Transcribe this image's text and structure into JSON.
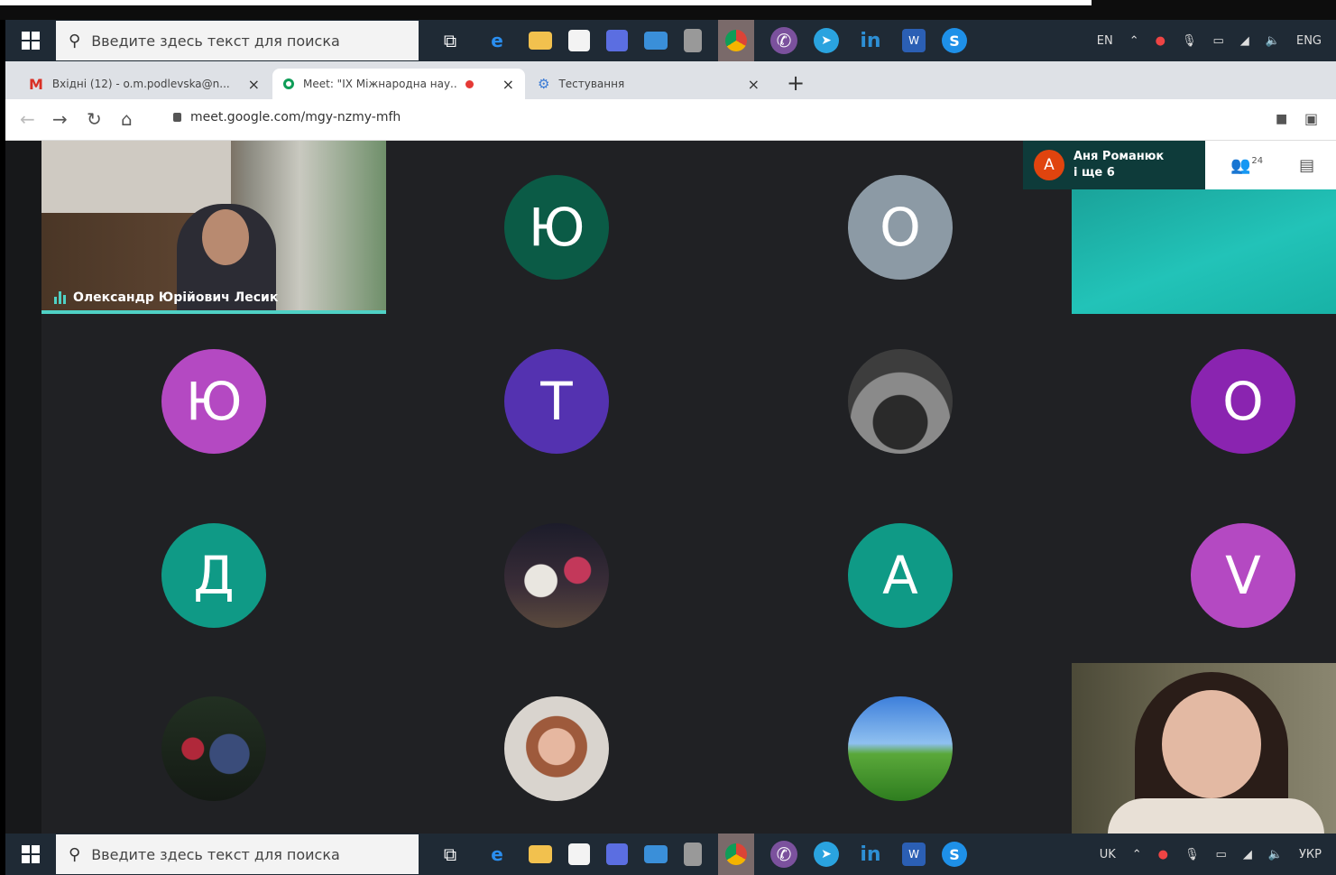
{
  "taskbar": {
    "search_placeholder": "Введите здесь текст для поиска",
    "tray_lang_top": "ENG",
    "tray_lang_bottom": "УКР",
    "tray_input_top": "EN",
    "tray_input_bottom": "UK"
  },
  "browser": {
    "tabs": [
      {
        "label": "Вхідні (12) - o.m.podlevska@n...",
        "icon": "gmail-icon"
      },
      {
        "label": "Meet: \"IX Міжнародна нау...",
        "icon": "meet-icon"
      },
      {
        "label": "Тестування",
        "icon": "tab-favicon"
      }
    ],
    "url": "meet.google.com/mgy-nzmy-mfh"
  },
  "meet": {
    "speaker_name": "Олександр Юрійович Лесик",
    "pill": {
      "initial": "А",
      "line1": "Аня Романюк",
      "line2": "і ще 6"
    },
    "participant_count": "24",
    "avatars": [
      {
        "letter": "Ю",
        "color": "#0b5b46"
      },
      {
        "letter": "О",
        "color": "#8c9aa5"
      },
      {
        "letter": "Ю",
        "color": "#b449c2"
      },
      {
        "letter": "Т",
        "color": "#5432b0"
      },
      {
        "letter": "О",
        "color": "#8a24b0"
      },
      {
        "letter": "Д",
        "color": "#0f9a86"
      },
      {
        "letter": "А",
        "color": "#0f9a86"
      },
      {
        "letter": "V",
        "color": "#b449c2"
      }
    ]
  }
}
